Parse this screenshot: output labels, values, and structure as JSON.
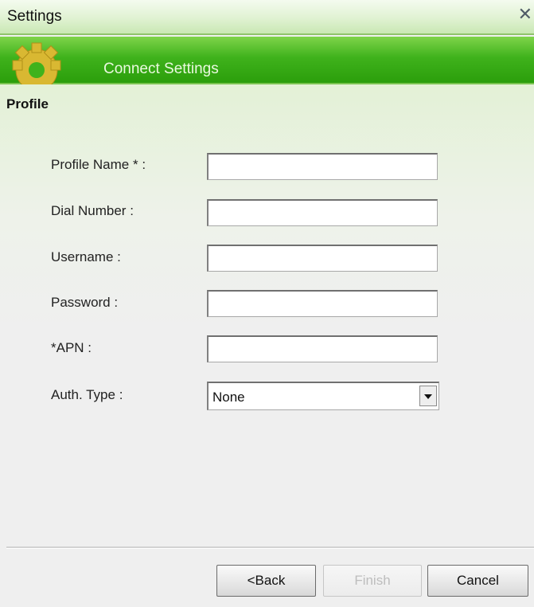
{
  "window": {
    "title": "Settings",
    "close_glyph": "✕"
  },
  "banner": {
    "title": "Connect Settings",
    "icon": "gear-icon"
  },
  "section": {
    "title": "Profile"
  },
  "form": {
    "fields": [
      {
        "label": "Profile Name * :",
        "value": ""
      },
      {
        "label": "Dial Number :",
        "value": ""
      },
      {
        "label": "Username :",
        "value": ""
      },
      {
        "label": "Password :",
        "value": ""
      },
      {
        "label": "*APN :",
        "value": ""
      }
    ],
    "auth": {
      "label": "Auth. Type :",
      "selected": "None"
    }
  },
  "buttons": {
    "back": "<Back",
    "finish": "Finish",
    "cancel": "Cancel"
  },
  "colors": {
    "banner_green": "#2b9e0b",
    "titlebar_green": "#e0f2d2",
    "gear": "#d9b832"
  }
}
